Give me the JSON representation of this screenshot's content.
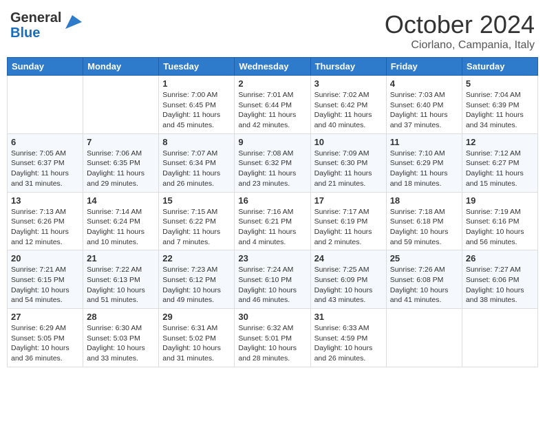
{
  "header": {
    "logo_general": "General",
    "logo_blue": "Blue",
    "month_year": "October 2024",
    "location": "Ciorlano, Campania, Italy"
  },
  "days_of_week": [
    "Sunday",
    "Monday",
    "Tuesday",
    "Wednesday",
    "Thursday",
    "Friday",
    "Saturday"
  ],
  "weeks": [
    [
      {
        "day": "",
        "info": ""
      },
      {
        "day": "",
        "info": ""
      },
      {
        "day": "1",
        "info": "Sunrise: 7:00 AM\nSunset: 6:45 PM\nDaylight: 11 hours and 45 minutes."
      },
      {
        "day": "2",
        "info": "Sunrise: 7:01 AM\nSunset: 6:44 PM\nDaylight: 11 hours and 42 minutes."
      },
      {
        "day": "3",
        "info": "Sunrise: 7:02 AM\nSunset: 6:42 PM\nDaylight: 11 hours and 40 minutes."
      },
      {
        "day": "4",
        "info": "Sunrise: 7:03 AM\nSunset: 6:40 PM\nDaylight: 11 hours and 37 minutes."
      },
      {
        "day": "5",
        "info": "Sunrise: 7:04 AM\nSunset: 6:39 PM\nDaylight: 11 hours and 34 minutes."
      }
    ],
    [
      {
        "day": "6",
        "info": "Sunrise: 7:05 AM\nSunset: 6:37 PM\nDaylight: 11 hours and 31 minutes."
      },
      {
        "day": "7",
        "info": "Sunrise: 7:06 AM\nSunset: 6:35 PM\nDaylight: 11 hours and 29 minutes."
      },
      {
        "day": "8",
        "info": "Sunrise: 7:07 AM\nSunset: 6:34 PM\nDaylight: 11 hours and 26 minutes."
      },
      {
        "day": "9",
        "info": "Sunrise: 7:08 AM\nSunset: 6:32 PM\nDaylight: 11 hours and 23 minutes."
      },
      {
        "day": "10",
        "info": "Sunrise: 7:09 AM\nSunset: 6:30 PM\nDaylight: 11 hours and 21 minutes."
      },
      {
        "day": "11",
        "info": "Sunrise: 7:10 AM\nSunset: 6:29 PM\nDaylight: 11 hours and 18 minutes."
      },
      {
        "day": "12",
        "info": "Sunrise: 7:12 AM\nSunset: 6:27 PM\nDaylight: 11 hours and 15 minutes."
      }
    ],
    [
      {
        "day": "13",
        "info": "Sunrise: 7:13 AM\nSunset: 6:26 PM\nDaylight: 11 hours and 12 minutes."
      },
      {
        "day": "14",
        "info": "Sunrise: 7:14 AM\nSunset: 6:24 PM\nDaylight: 11 hours and 10 minutes."
      },
      {
        "day": "15",
        "info": "Sunrise: 7:15 AM\nSunset: 6:22 PM\nDaylight: 11 hours and 7 minutes."
      },
      {
        "day": "16",
        "info": "Sunrise: 7:16 AM\nSunset: 6:21 PM\nDaylight: 11 hours and 4 minutes."
      },
      {
        "day": "17",
        "info": "Sunrise: 7:17 AM\nSunset: 6:19 PM\nDaylight: 11 hours and 2 minutes."
      },
      {
        "day": "18",
        "info": "Sunrise: 7:18 AM\nSunset: 6:18 PM\nDaylight: 10 hours and 59 minutes."
      },
      {
        "day": "19",
        "info": "Sunrise: 7:19 AM\nSunset: 6:16 PM\nDaylight: 10 hours and 56 minutes."
      }
    ],
    [
      {
        "day": "20",
        "info": "Sunrise: 7:21 AM\nSunset: 6:15 PM\nDaylight: 10 hours and 54 minutes."
      },
      {
        "day": "21",
        "info": "Sunrise: 7:22 AM\nSunset: 6:13 PM\nDaylight: 10 hours and 51 minutes."
      },
      {
        "day": "22",
        "info": "Sunrise: 7:23 AM\nSunset: 6:12 PM\nDaylight: 10 hours and 49 minutes."
      },
      {
        "day": "23",
        "info": "Sunrise: 7:24 AM\nSunset: 6:10 PM\nDaylight: 10 hours and 46 minutes."
      },
      {
        "day": "24",
        "info": "Sunrise: 7:25 AM\nSunset: 6:09 PM\nDaylight: 10 hours and 43 minutes."
      },
      {
        "day": "25",
        "info": "Sunrise: 7:26 AM\nSunset: 6:08 PM\nDaylight: 10 hours and 41 minutes."
      },
      {
        "day": "26",
        "info": "Sunrise: 7:27 AM\nSunset: 6:06 PM\nDaylight: 10 hours and 38 minutes."
      }
    ],
    [
      {
        "day": "27",
        "info": "Sunrise: 6:29 AM\nSunset: 5:05 PM\nDaylight: 10 hours and 36 minutes."
      },
      {
        "day": "28",
        "info": "Sunrise: 6:30 AM\nSunset: 5:03 PM\nDaylight: 10 hours and 33 minutes."
      },
      {
        "day": "29",
        "info": "Sunrise: 6:31 AM\nSunset: 5:02 PM\nDaylight: 10 hours and 31 minutes."
      },
      {
        "day": "30",
        "info": "Sunrise: 6:32 AM\nSunset: 5:01 PM\nDaylight: 10 hours and 28 minutes."
      },
      {
        "day": "31",
        "info": "Sunrise: 6:33 AM\nSunset: 4:59 PM\nDaylight: 10 hours and 26 minutes."
      },
      {
        "day": "",
        "info": ""
      },
      {
        "day": "",
        "info": ""
      }
    ]
  ]
}
